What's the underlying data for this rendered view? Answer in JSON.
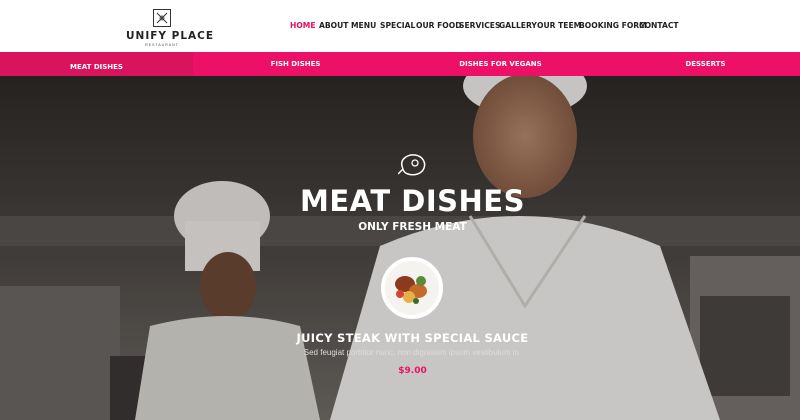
{
  "brand": {
    "name": "UNIFY PLACE",
    "tagline": "RESTAURANT"
  },
  "nav": {
    "items": [
      {
        "label": "HOME",
        "active": true
      },
      {
        "label": "ABOUT",
        "active": false
      },
      {
        "label": "MENU",
        "active": false
      },
      {
        "label": "SPECIAL",
        "active": false
      },
      {
        "label": "OUR FOOD",
        "active": false
      },
      {
        "label": "SERVICES",
        "active": false
      },
      {
        "label": "GALLERY",
        "active": false
      },
      {
        "label": "OUR TEEM",
        "active": false
      },
      {
        "label": "BOOKING FORM",
        "active": false
      },
      {
        "label": "CONTACT",
        "active": false
      }
    ]
  },
  "tabs": [
    {
      "label": "MEAT DISHES",
      "active": true
    },
    {
      "label": "FISH DISHES",
      "active": false
    },
    {
      "label": "DISHES FOR VEGANS",
      "active": false
    },
    {
      "label": "DESSERTS",
      "active": false
    }
  ],
  "hero": {
    "icon": "steak-icon",
    "title": "MEAT DISHES",
    "subtitle": "ONLY FRESH MEAT",
    "dish": {
      "name": "JUICY STEAK WITH SPECIAL SAUCE",
      "description": "Sed feugiat porttitor nunc, non dignissim ipsum vestibulum in.",
      "price": "$9.00"
    }
  },
  "colors": {
    "accent": "#ec1166",
    "active_tab": "#d9135c",
    "text_dark": "#222222"
  }
}
